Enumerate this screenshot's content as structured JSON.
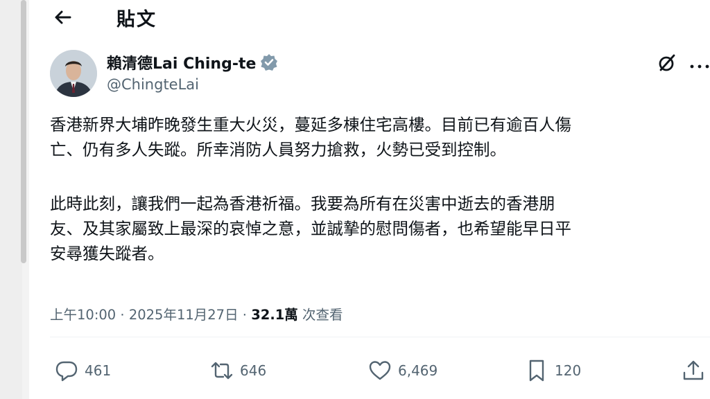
{
  "header": {
    "title": "貼文"
  },
  "author": {
    "display_name": "賴清德Lai Ching-te",
    "handle": "@ChingteLai"
  },
  "post": {
    "paragraph1_line1": "香港新界大埔昨晚發生重大火災，蔓延多棟住宅高樓。目前已有逾百人傷",
    "paragraph1_line2": "亡、仍有多人失蹤。所幸消防人員努力搶救，火勢已受到控制。",
    "paragraph2_line1": "此時此刻，讓我們一起為香港祈福。我要為所有在災害中逝去的香港朋",
    "paragraph2_line2": "友、及其家屬致上最深的哀悼之意，並誠摯的慰問傷者，也希望能早日平",
    "paragraph2_line3": "安尋獲失蹤者。"
  },
  "meta": {
    "time": "上午10:00",
    "sep1": " · ",
    "date": "2025年11月27日",
    "sep2": " · ",
    "views_count": "32.1萬",
    "views_label": " 次查看"
  },
  "actions": {
    "replies": "461",
    "reposts": "646",
    "likes": "6,469",
    "bookmarks": "120"
  },
  "icons": {
    "back": "arrow-left-icon",
    "verified": "verified-badge-icon",
    "grok": "grok-icon",
    "more": "more-horizontal-icon",
    "reply": "reply-icon",
    "repost": "repost-icon",
    "like": "heart-icon",
    "bookmark": "bookmark-icon",
    "share": "share-icon"
  },
  "colors": {
    "text": "#0f1419",
    "secondary": "#536471",
    "verified_badge": "#829aab"
  }
}
